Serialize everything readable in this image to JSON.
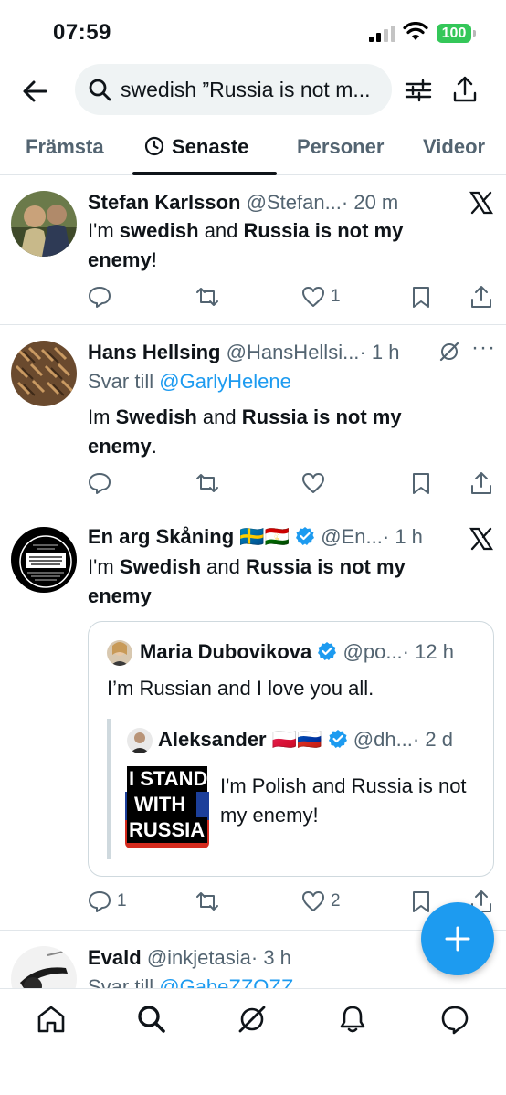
{
  "status": {
    "time": "07:59",
    "battery": "100"
  },
  "search": {
    "query": "swedish ”Russia is not m..."
  },
  "tabs": [
    {
      "label": "Främsta"
    },
    {
      "label": "Senaste"
    },
    {
      "label": "Personer"
    },
    {
      "label": "Videor"
    }
  ],
  "tweets": [
    {
      "name": "Stefan Karlsson",
      "handle": "@Stefan...",
      "time": "· 20 m",
      "text": [
        "I'm ",
        "swedish",
        " and ",
        "Russia is not my enemy",
        "!"
      ],
      "likes": "1"
    },
    {
      "name": "Hans Hellsing",
      "handle": "@HansHellsi...",
      "time": "· 1 h",
      "reply_prefix": "Svar till ",
      "reply_to": "@GarlyHelene",
      "text": [
        "Im ",
        "Swedish",
        " and ",
        "Russia is not my enemy",
        "."
      ]
    },
    {
      "name": "En arg Skåning 🇸🇪🇹🇯",
      "handle": "@En...",
      "time": "· 1 h",
      "avatar_text": "I DIDN'T GET MY FLU & COVID SHOT!",
      "text": [
        "I'm ",
        "Swedish",
        " and ",
        "Russia is not my enemy",
        ""
      ],
      "quote": {
        "name": "Maria Dubovikova",
        "handle": "@po...",
        "time": "· 12 h",
        "text": "I’m Russian and I love you all.",
        "inner": {
          "name": "Aleksander 🇵🇱🇷🇺",
          "handle": "@dh...",
          "time": "· 2 d",
          "text": "I'm Polish and Russia is not my enemy!",
          "image_lines": [
            "I STAND",
            "WITH",
            "RUSSIA"
          ]
        }
      },
      "replies": "1",
      "likes": "2"
    },
    {
      "name": "Evald",
      "handle": "@inkjetasia",
      "time": "· 3 h",
      "reply_prefix": "Svar till ",
      "reply_to": "@GabeZZOZZ"
    }
  ],
  "colors": {
    "accent": "#1d9bf0",
    "text": "#0f1419",
    "muted": "#536471",
    "battery": "#34c759"
  }
}
